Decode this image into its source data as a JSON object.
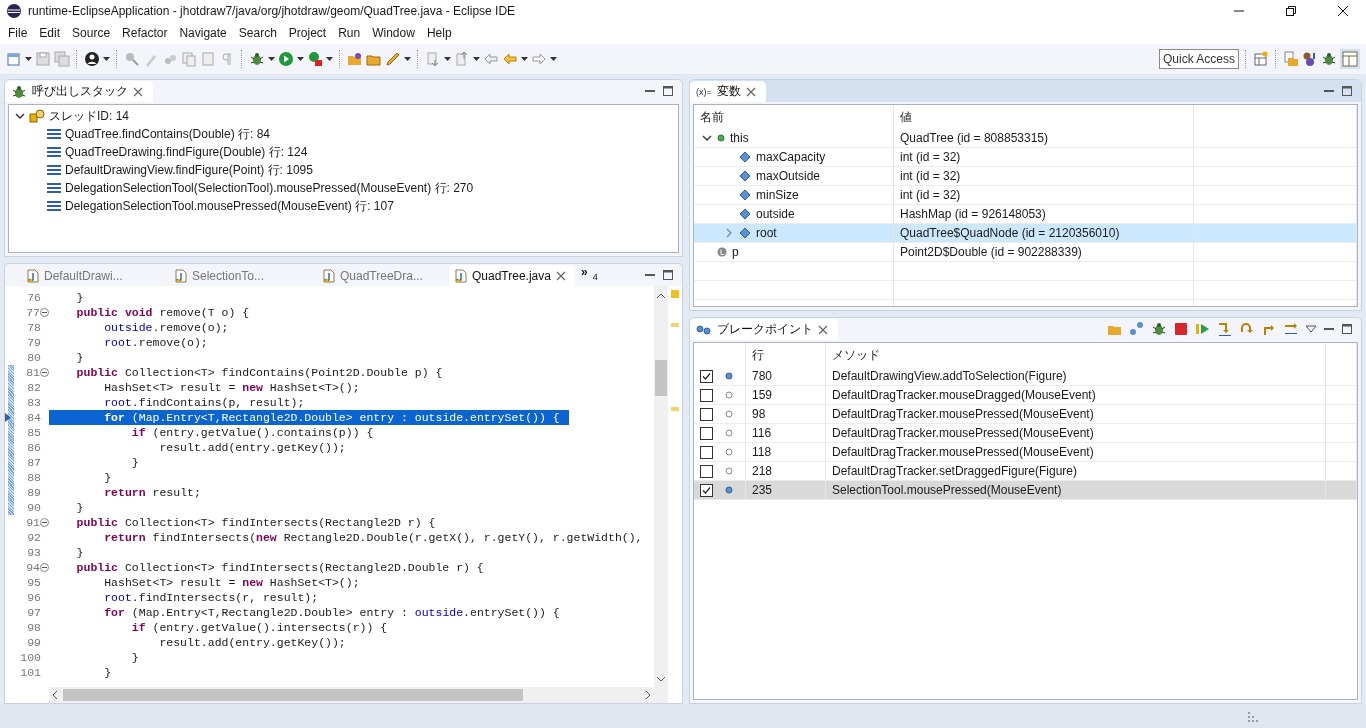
{
  "window": {
    "title": "runtime-EclipseApplication - jhotdraw7/java/org/jhotdraw/geom/QuadTree.java - Eclipse IDE"
  },
  "menu": [
    "File",
    "Edit",
    "Source",
    "Refactor",
    "Navigate",
    "Search",
    "Project",
    "Run",
    "Window",
    "Help"
  ],
  "quick_access": {
    "placeholder": "Quick Access"
  },
  "call_stack": {
    "tab": {
      "label": "呼び出しスタック",
      "selected": true
    },
    "threads": [
      {
        "label": "スレッドID: 14",
        "expanded": true,
        "children": [
          {
            "label": "QuadTree.findContains(Double) 行: 84"
          },
          {
            "label": "QuadTreeDrawing.findFigure(Double) 行: 124"
          },
          {
            "label": "DefaultDrawingView.findFigure(Point) 行: 1095"
          },
          {
            "label": "DelegationSelectionTool(SelectionTool).mousePressed(MouseEvent) 行: 270"
          },
          {
            "label": "DelegationSelectionTool.mousePressed(MouseEvent) 行: 107"
          }
        ]
      }
    ]
  },
  "editor": {
    "tabs": [
      {
        "label": "DefaultDrawi...",
        "selected": false
      },
      {
        "label": "SelectionTo...",
        "selected": false
      },
      {
        "label": "QuadTreeDra...",
        "selected": false
      },
      {
        "label": "QuadTree.java",
        "selected": true
      }
    ],
    "overflow": {
      "mark": "»",
      "count": "4"
    },
    "lines": [
      {
        "number": "76",
        "fold": false,
        "scope": false,
        "selected": false,
        "segments": [
          {
            "kind": "plain",
            "text": "    }"
          }
        ]
      },
      {
        "number": "77",
        "fold": true,
        "scope": false,
        "selected": false,
        "segments": [
          {
            "kind": "kw",
            "text": "    public void"
          },
          {
            "kind": "plain",
            "text": " remove(T o) {"
          }
        ]
      },
      {
        "number": "78",
        "fold": false,
        "scope": false,
        "selected": false,
        "segments": [
          {
            "kind": "field",
            "text": "        outside"
          },
          {
            "kind": "plain",
            "text": ".remove(o);"
          }
        ]
      },
      {
        "number": "79",
        "fold": false,
        "scope": false,
        "selected": false,
        "segments": [
          {
            "kind": "field",
            "text": "        root"
          },
          {
            "kind": "plain",
            "text": ".remove(o);"
          }
        ]
      },
      {
        "number": "80",
        "fold": false,
        "scope": false,
        "selected": false,
        "segments": [
          {
            "kind": "plain",
            "text": "    }"
          }
        ]
      },
      {
        "number": "81",
        "fold": true,
        "scope": true,
        "selected": false,
        "segments": [
          {
            "kind": "kw",
            "text": "    public"
          },
          {
            "kind": "plain",
            "text": " Collection<T> findContains(Point2D.Double p) {"
          }
        ]
      },
      {
        "number": "82",
        "fold": false,
        "scope": true,
        "selected": false,
        "segments": [
          {
            "kind": "plain",
            "text": "        HashSet<T> result = "
          },
          {
            "kind": "kw",
            "text": "new"
          },
          {
            "kind": "plain",
            "text": " HashSet<T>();"
          }
        ]
      },
      {
        "number": "83",
        "fold": false,
        "scope": true,
        "selected": false,
        "segments": [
          {
            "kind": "field",
            "text": "        root"
          },
          {
            "kind": "plain",
            "text": ".findContains(p, result);"
          }
        ]
      },
      {
        "number": "84",
        "fold": false,
        "scope": true,
        "selected": true,
        "segments": [
          {
            "kind": "kw",
            "text": "        for"
          },
          {
            "kind": "plain",
            "text": " (Map.Entry<T,Rectangle2D.Double> entry : "
          },
          {
            "kind": "field",
            "text": "outside"
          },
          {
            "kind": "plain",
            "text": ".entrySet()) {"
          }
        ]
      },
      {
        "number": "85",
        "fold": false,
        "scope": true,
        "selected": false,
        "segments": [
          {
            "kind": "kw",
            "text": "            if"
          },
          {
            "kind": "plain",
            "text": " (entry.getValue().contains(p)) {"
          }
        ]
      },
      {
        "number": "86",
        "fold": false,
        "scope": true,
        "selected": false,
        "segments": [
          {
            "kind": "plain",
            "text": "                result.add(entry.getKey());"
          }
        ]
      },
      {
        "number": "87",
        "fold": false,
        "scope": true,
        "selected": false,
        "segments": [
          {
            "kind": "plain",
            "text": "            }"
          }
        ]
      },
      {
        "number": "88",
        "fold": false,
        "scope": true,
        "selected": false,
        "segments": [
          {
            "kind": "plain",
            "text": "        }"
          }
        ]
      },
      {
        "number": "89",
        "fold": false,
        "scope": true,
        "selected": false,
        "segments": [
          {
            "kind": "kw",
            "text": "        return"
          },
          {
            "kind": "plain",
            "text": " result;"
          }
        ]
      },
      {
        "number": "90",
        "fold": false,
        "scope": true,
        "selected": false,
        "segments": [
          {
            "kind": "plain",
            "text": "    }"
          }
        ]
      },
      {
        "number": "91",
        "fold": true,
        "scope": false,
        "selected": false,
        "segments": [
          {
            "kind": "kw",
            "text": "    public"
          },
          {
            "kind": "plain",
            "text": " Collection<T> findIntersects(Rectangle2D r) {"
          }
        ]
      },
      {
        "number": "92",
        "fold": false,
        "scope": false,
        "selected": false,
        "segments": [
          {
            "kind": "kw",
            "text": "        return"
          },
          {
            "kind": "plain",
            "text": " findIntersects("
          },
          {
            "kind": "kw",
            "text": "new"
          },
          {
            "kind": "plain",
            "text": " Rectangle2D.Double(r.getX(), r.getY(), r.getWidth(),"
          }
        ]
      },
      {
        "number": "93",
        "fold": false,
        "scope": false,
        "selected": false,
        "segments": [
          {
            "kind": "plain",
            "text": "    }"
          }
        ]
      },
      {
        "number": "94",
        "fold": true,
        "scope": false,
        "selected": false,
        "segments": [
          {
            "kind": "kw",
            "text": "    public"
          },
          {
            "kind": "plain",
            "text": " Collection<T> findIntersects(Rectangle2D.Double r) {"
          }
        ]
      },
      {
        "number": "95",
        "fold": false,
        "scope": false,
        "selected": false,
        "segments": [
          {
            "kind": "plain",
            "text": "        HashSet<T> result = "
          },
          {
            "kind": "kw",
            "text": "new"
          },
          {
            "kind": "plain",
            "text": " HashSet<T>();"
          }
        ]
      },
      {
        "number": "96",
        "fold": false,
        "scope": false,
        "selected": false,
        "segments": [
          {
            "kind": "field",
            "text": "        root"
          },
          {
            "kind": "plain",
            "text": ".findIntersects(r, result);"
          }
        ]
      },
      {
        "number": "97",
        "fold": false,
        "scope": false,
        "selected": false,
        "segments": [
          {
            "kind": "kw",
            "text": "        for"
          },
          {
            "kind": "plain",
            "text": " (Map.Entry<T,Rectangle2D.Double> entry : "
          },
          {
            "kind": "field",
            "text": "outside"
          },
          {
            "kind": "plain",
            "text": ".entrySet()) {"
          }
        ]
      },
      {
        "number": "98",
        "fold": false,
        "scope": false,
        "selected": false,
        "segments": [
          {
            "kind": "kw",
            "text": "            if"
          },
          {
            "kind": "plain",
            "text": " (entry.getValue().intersects(r)) {"
          }
        ]
      },
      {
        "number": "99",
        "fold": false,
        "scope": false,
        "selected": false,
        "segments": [
          {
            "kind": "plain",
            "text": "                result.add(entry.getKey());"
          }
        ]
      },
      {
        "number": "100",
        "fold": false,
        "scope": false,
        "selected": false,
        "segments": [
          {
            "kind": "plain",
            "text": "            }"
          }
        ]
      },
      {
        "number": "101",
        "fold": false,
        "scope": false,
        "selected": false,
        "segments": [
          {
            "kind": "plain",
            "text": "        }"
          }
        ]
      }
    ]
  },
  "variables": {
    "tab": {
      "icon_text": "(x)=",
      "label": "変数",
      "selected": true
    },
    "columns": [
      "名前",
      "値"
    ],
    "rows": [
      {
        "kind": "object",
        "name": "this",
        "value": "QuadTree (id = 808853315)",
        "expanded": true,
        "selected": false,
        "children": [
          {
            "kind": "field",
            "name": "maxCapacity",
            "value": "int (id = 32)",
            "selected": false
          },
          {
            "kind": "field",
            "name": "maxOutside",
            "value": "int (id = 32)",
            "selected": false
          },
          {
            "kind": "field",
            "name": "minSize",
            "value": "int (id = 32)",
            "selected": false
          },
          {
            "kind": "field",
            "name": "outside",
            "value": "HashMap (id = 926148053)",
            "selected": false
          },
          {
            "kind": "field",
            "name": "root",
            "value": "QuadTree$QuadNode (id = 2120356010)",
            "expanded": false,
            "selected": true
          }
        ]
      },
      {
        "kind": "local",
        "name": "p",
        "value": "Point2D$Double (id = 902288339)",
        "selected": false
      }
    ]
  },
  "breakpoints": {
    "tab": {
      "label": "ブレークポイント",
      "selected": true
    },
    "columns": [
      "行",
      "メソッド"
    ],
    "rows": [
      {
        "checked": true,
        "line": "780",
        "method": "DefaultDrawingView.addToSelection(Figure)",
        "selected": false
      },
      {
        "checked": false,
        "line": "159",
        "method": "DefaultDragTracker.mouseDragged(MouseEvent)",
        "selected": false
      },
      {
        "checked": false,
        "line": "98",
        "method": "DefaultDragTracker.mousePressed(MouseEvent)",
        "selected": false
      },
      {
        "checked": false,
        "line": "116",
        "method": "DefaultDragTracker.mousePressed(MouseEvent)",
        "selected": false
      },
      {
        "checked": false,
        "line": "118",
        "method": "DefaultDragTracker.mousePressed(MouseEvent)",
        "selected": false
      },
      {
        "checked": false,
        "line": "218",
        "method": "DefaultDragTracker.setDraggedFigure(Figure)",
        "selected": false
      },
      {
        "checked": true,
        "line": "235",
        "method": "SelectionTool.mousePressed(MouseEvent)",
        "selected": true
      }
    ]
  }
}
